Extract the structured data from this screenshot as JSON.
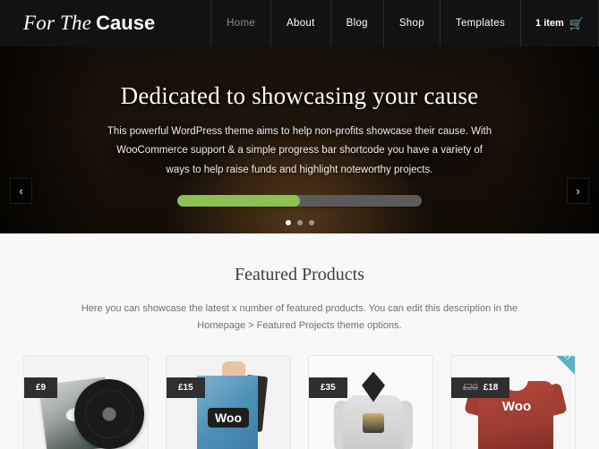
{
  "header": {
    "logo_primary": "For The",
    "logo_secondary": "Cause",
    "nav": [
      {
        "label": "Home",
        "active": true
      },
      {
        "label": "About",
        "active": false
      },
      {
        "label": "Blog",
        "active": false
      },
      {
        "label": "Shop",
        "active": false
      },
      {
        "label": "Templates",
        "active": false
      }
    ],
    "cart": {
      "label": "1 item",
      "icon": "shopping-cart-icon",
      "icon_color": "#7fc4e0"
    },
    "background_color": "#121212"
  },
  "hero": {
    "title": "Dedicated to showcasing your cause",
    "description": "This powerful WordPress theme aims to help non-profits showcase their cause. With WooCommerce support & a simple progress bar shortcode you have a variety of ways to help raise funds and highlight noteworthy projects.",
    "progress": {
      "percent": 50,
      "fill_color": "#8dc153",
      "track_color": "#5b5b5b"
    },
    "slider_dots": [
      {
        "active": true
      },
      {
        "active": false
      },
      {
        "active": false
      }
    ],
    "prev_arrow": "‹",
    "next_arrow": "›",
    "background_image": "tiger-face-photo"
  },
  "featured": {
    "title": "Featured Products",
    "description": "Here you can showcase the latest x number of featured products. You can edit this description in the Homepage > Featured Projects theme options.",
    "products": [
      {
        "price": "£9",
        "old_price": "",
        "on_sale": false,
        "image": "vinyl-record-product-image"
      },
      {
        "price": "£15",
        "old_price": "",
        "on_sale": false,
        "image": "woo-poster-product-image"
      },
      {
        "price": "£35",
        "old_price": "",
        "on_sale": false,
        "image": "grey-hoodie-product-image"
      },
      {
        "price": "£18",
        "old_price": "£20",
        "on_sale": true,
        "sale_label": "SALE!",
        "sale_color": "#5cafc9",
        "image": "red-woo-tshirt-product-image",
        "shirt_text": "Woo"
      }
    ],
    "background_color": "#f8f8f8"
  }
}
